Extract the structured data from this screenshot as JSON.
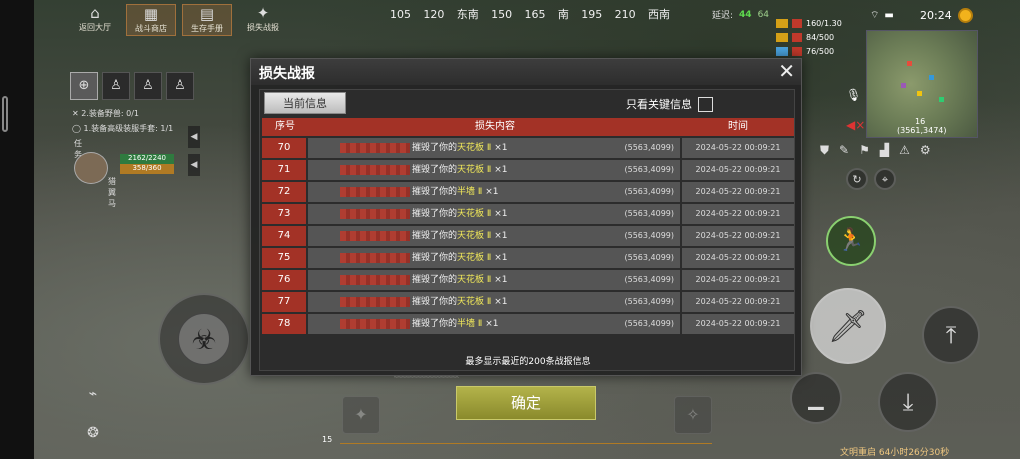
{
  "hud": {
    "top_menu": [
      {
        "label": "返回大厅",
        "icon": "home-icon"
      },
      {
        "label": "战斗商店",
        "icon": "shop-icon"
      },
      {
        "label": "生存手册",
        "icon": "book-icon"
      },
      {
        "label": "损失战报",
        "icon": "report-icon"
      }
    ],
    "compass": [
      "105",
      "120",
      "东南",
      "150",
      "165",
      "南",
      "195",
      "210",
      "西南"
    ],
    "delay_label": "延迟:",
    "delay_value": "44",
    "other_value": "64",
    "clock": "20:24",
    "resources": [
      {
        "value": "160/1.30",
        "color": "#c0392b"
      },
      {
        "value": "84/500",
        "color": "#d4a017"
      },
      {
        "value": "76/500",
        "color": "#4aa3df"
      }
    ],
    "minimap_coords": "(3561,3474)",
    "minimap_level": "16",
    "quests": [
      {
        "mark": "✕",
        "text": "2.装备野兽: 0/1"
      },
      {
        "mark": "◯",
        "text": "1.装备高级装服手套: 1/1"
      }
    ],
    "task_label": "任务",
    "player": {
      "hp": "2162/2240",
      "energy": "358/360",
      "name": "猎翼马"
    },
    "bottom_num": "15",
    "restart_text": "文明重启 64小时26分30秒"
  },
  "dialog": {
    "title": "损失战报",
    "tab_current": "当前信息",
    "key_filter_label": "只看关键信息",
    "key_filter_checked": false,
    "columns": [
      "序号",
      "损失内容",
      "时间"
    ],
    "rows": [
      {
        "idx": "70",
        "pre": "摧毁了你的",
        "item": "天花板 Ⅱ",
        "qty": "×1",
        "coord": "(5563,4099)",
        "time": "2024-05-22 00:09:21"
      },
      {
        "idx": "71",
        "pre": "摧毁了你的",
        "item": "天花板 Ⅱ",
        "qty": "×1",
        "coord": "(5563,4099)",
        "time": "2024-05-22 00:09:21"
      },
      {
        "idx": "72",
        "pre": "摧毁了你的",
        "item": "半墙 Ⅱ",
        "qty": "×1",
        "coord": "(5563,4099)",
        "time": "2024-05-22 00:09:21"
      },
      {
        "idx": "73",
        "pre": "摧毁了你的",
        "item": "天花板 Ⅱ",
        "qty": "×1",
        "coord": "(5563,4099)",
        "time": "2024-05-22 00:09:21"
      },
      {
        "idx": "74",
        "pre": "摧毁了你的",
        "item": "天花板 Ⅱ",
        "qty": "×1",
        "coord": "(5563,4099)",
        "time": "2024-05-22 00:09:21"
      },
      {
        "idx": "75",
        "pre": "摧毁了你的",
        "item": "天花板 Ⅱ",
        "qty": "×1",
        "coord": "(5563,4099)",
        "time": "2024-05-22 00:09:21"
      },
      {
        "idx": "76",
        "pre": "摧毁了你的",
        "item": "天花板 Ⅱ",
        "qty": "×1",
        "coord": "(5563,4099)",
        "time": "2024-05-22 00:09:21"
      },
      {
        "idx": "77",
        "pre": "摧毁了你的",
        "item": "天花板 Ⅱ",
        "qty": "×1",
        "coord": "(5563,4099)",
        "time": "2024-05-22 00:09:21"
      },
      {
        "idx": "78",
        "pre": "摧毁了你的",
        "item": "半墙 Ⅱ",
        "qty": "×1",
        "coord": "(5563,4099)",
        "time": "2024-05-22 00:09:21"
      }
    ],
    "footer_note": "最多显示最近的200条战报信息",
    "confirm_label": "确定"
  },
  "colors": {
    "accent_red": "#a33226",
    "item_yellow": "#f3ea5a",
    "confirm_olive": "#9c9c3a"
  }
}
